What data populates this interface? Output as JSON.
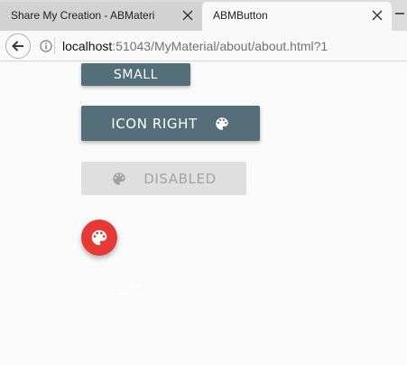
{
  "browser": {
    "tabs": [
      {
        "title": "Share My Creation - ABMateri",
        "active": false
      },
      {
        "title": "ABMButton",
        "active": true
      }
    ],
    "url": {
      "host": "localhost",
      "rest": ":51043/MyMaterial/about/about.html?1"
    }
  },
  "page": {
    "buttons": {
      "small_label": "SMALL",
      "icon_right_label": "ICON RIGHT",
      "disabled_label": "DISABLED",
      "flat_label": "FLAT"
    },
    "icons": {
      "palette": "palette-icon"
    }
  },
  "colors": {
    "primary_button": "#546e7a",
    "fab": "#e53935",
    "disabled_button": "#dfdfdf",
    "page_background": "#fafafa"
  }
}
